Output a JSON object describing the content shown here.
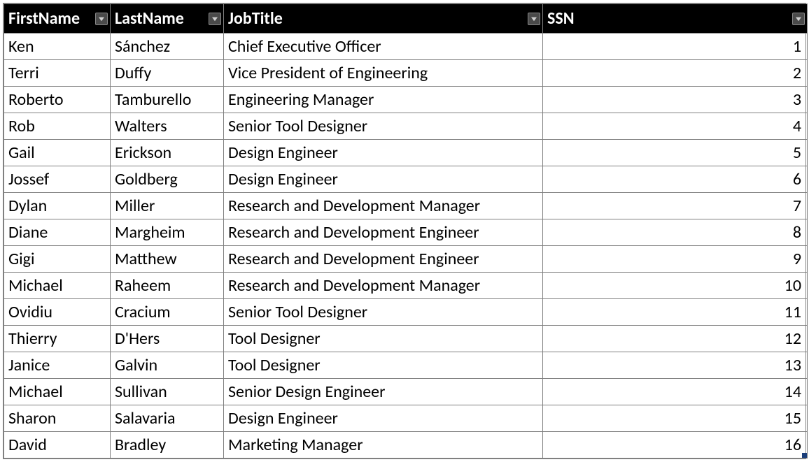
{
  "columns": [
    {
      "key": "firstName",
      "label": "FirstName"
    },
    {
      "key": "lastName",
      "label": "LastName"
    },
    {
      "key": "jobTitle",
      "label": "JobTitle"
    },
    {
      "key": "ssn",
      "label": "SSN",
      "numeric": true
    }
  ],
  "rows": [
    {
      "firstName": "Ken",
      "lastName": "Sánchez",
      "jobTitle": "Chief Executive Officer",
      "ssn": 1
    },
    {
      "firstName": "Terri",
      "lastName": "Duffy",
      "jobTitle": "Vice President of Engineering",
      "ssn": 2
    },
    {
      "firstName": "Roberto",
      "lastName": "Tamburello",
      "jobTitle": "Engineering Manager",
      "ssn": 3
    },
    {
      "firstName": "Rob",
      "lastName": "Walters",
      "jobTitle": "Senior Tool Designer",
      "ssn": 4
    },
    {
      "firstName": "Gail",
      "lastName": "Erickson",
      "jobTitle": "Design Engineer",
      "ssn": 5
    },
    {
      "firstName": "Jossef",
      "lastName": "Goldberg",
      "jobTitle": "Design Engineer",
      "ssn": 6
    },
    {
      "firstName": "Dylan",
      "lastName": "Miller",
      "jobTitle": "Research and Development Manager",
      "ssn": 7
    },
    {
      "firstName": "Diane",
      "lastName": "Margheim",
      "jobTitle": "Research and Development Engineer",
      "ssn": 8
    },
    {
      "firstName": "Gigi",
      "lastName": "Matthew",
      "jobTitle": "Research and Development Engineer",
      "ssn": 9
    },
    {
      "firstName": "Michael",
      "lastName": "Raheem",
      "jobTitle": "Research and Development Manager",
      "ssn": 10
    },
    {
      "firstName": "Ovidiu",
      "lastName": "Cracium",
      "jobTitle": "Senior Tool Designer",
      "ssn": 11
    },
    {
      "firstName": "Thierry",
      "lastName": "D'Hers",
      "jobTitle": "Tool Designer",
      "ssn": 12
    },
    {
      "firstName": "Janice",
      "lastName": "Galvin",
      "jobTitle": "Tool Designer",
      "ssn": 13
    },
    {
      "firstName": "Michael",
      "lastName": "Sullivan",
      "jobTitle": "Senior Design Engineer",
      "ssn": 14
    },
    {
      "firstName": "Sharon",
      "lastName": "Salavaria",
      "jobTitle": "Design Engineer",
      "ssn": 15
    },
    {
      "firstName": "David",
      "lastName": "Bradley",
      "jobTitle": "Marketing Manager",
      "ssn": 16
    }
  ]
}
